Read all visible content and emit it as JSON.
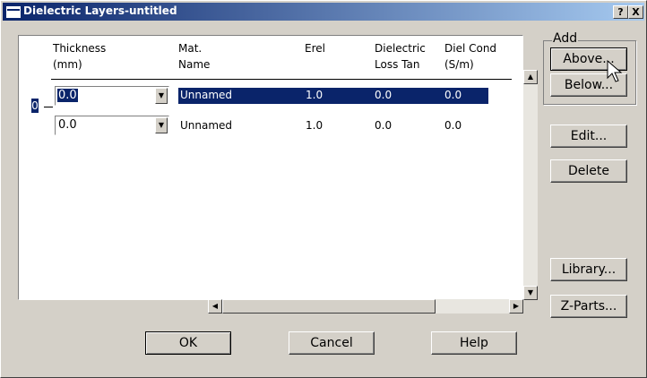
{
  "window": {
    "title": "Dielectric Layers-untitled",
    "help_btn": "?",
    "close_btn": "X"
  },
  "table": {
    "headers": [
      {
        "line1": "Thickness",
        "line2": "(mm)"
      },
      {
        "line1": "Mat.",
        "line2": "Name"
      },
      {
        "line1": "Erel",
        "line2": ""
      },
      {
        "line1": "Dielectric",
        "line2": "Loss Tan"
      },
      {
        "line1": "Diel Cond",
        "line2": "(S/m)"
      }
    ],
    "rows": [
      {
        "index": "0",
        "thickness": "0.0",
        "name": "Unnamed",
        "erel": "1.0",
        "loss_tan": "0.0",
        "cond": "0.0",
        "selected": true
      },
      {
        "index": "",
        "thickness": "0.0",
        "name": "Unnamed",
        "erel": "1.0",
        "loss_tan": "0.0",
        "cond": "0.0",
        "selected": false
      }
    ]
  },
  "side": {
    "add_group": "Add",
    "above": "Above...",
    "below": "Below...",
    "edit": "Edit...",
    "delete": "Delete",
    "library": "Library...",
    "zparts": "Z-Parts..."
  },
  "footer": {
    "ok": "OK",
    "cancel": "Cancel",
    "help": "Help"
  },
  "colors": {
    "selection": "#0a246a",
    "face": "#d4d0c8"
  }
}
